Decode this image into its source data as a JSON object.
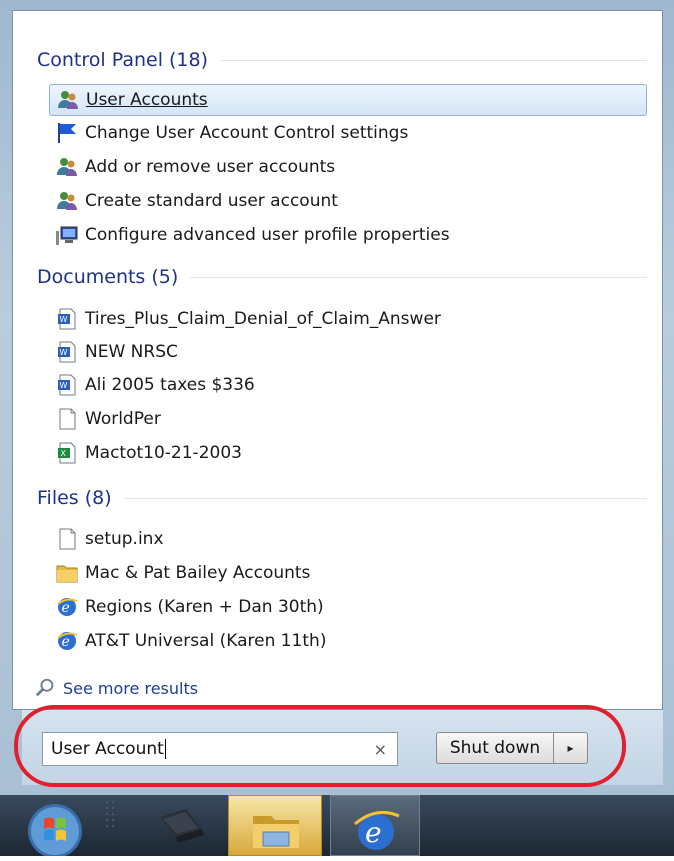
{
  "control_panel": {
    "title": "Control Panel (18)",
    "items": [
      {
        "label": "User Accounts",
        "icon": "user-accounts-icon"
      },
      {
        "label": "Change User Account Control settings",
        "icon": "uac-flag-icon"
      },
      {
        "label": "Add or remove user accounts",
        "icon": "user-accounts-icon"
      },
      {
        "label": "Create standard user account",
        "icon": "user-accounts-icon"
      },
      {
        "label": "Configure advanced user profile properties",
        "icon": "computer-profile-icon"
      }
    ]
  },
  "documents": {
    "title": "Documents (5)",
    "items": [
      {
        "label": "Tires_Plus_Claim_Denial_of_Claim_Answer",
        "icon": "word-document-icon"
      },
      {
        "label": "NEW NRSC",
        "icon": "word-document-icon"
      },
      {
        "label": "Ali 2005 taxes $336",
        "icon": "word-document-icon"
      },
      {
        "label": "WorldPer",
        "icon": "blank-file-icon"
      },
      {
        "label": "Mactot10-21-2003",
        "icon": "excel-document-icon"
      }
    ]
  },
  "files": {
    "title": "Files (8)",
    "items": [
      {
        "label": "setup.inx",
        "icon": "blank-file-icon"
      },
      {
        "label": "Mac & Pat Bailey Accounts",
        "icon": "folder-icon"
      },
      {
        "label": "Regions (Karen + Dan 30th)",
        "icon": "internet-explorer-icon"
      },
      {
        "label": "AT&T Universal (Karen 11th)",
        "icon": "internet-explorer-icon"
      }
    ]
  },
  "see_more": {
    "label": "See more results",
    "icon": "magnifier-icon"
  },
  "search": {
    "value": "User Account",
    "clear_icon": "×"
  },
  "shutdown": {
    "label": "Shut down",
    "arrow": "▸"
  },
  "colors": {
    "highlight_ring": "#e0202c",
    "section_title": "#1e3287",
    "link": "#1f3f95"
  }
}
